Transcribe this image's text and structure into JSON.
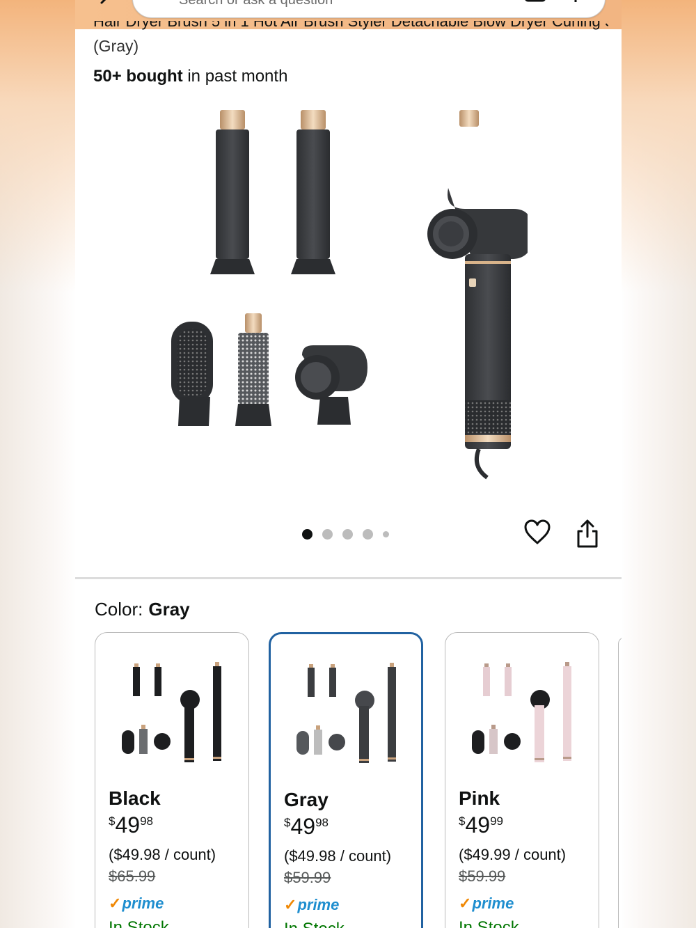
{
  "search": {
    "placeholder": "Search or ask a question"
  },
  "product": {
    "title_line_partial": "Hair Dryer Brush 5 in 1 Hot Air Brush Styler Detachable Blow Dryer Curling Styling Drying",
    "title_rest": "(Gray)",
    "bought_bold": "50+ bought",
    "bought_rest": " in past month"
  },
  "gallery": {
    "image_count": 5,
    "active_index": 0
  },
  "color_selector": {
    "label": "Color:",
    "selected": "Gray",
    "options": [
      {
        "name": "Black",
        "price_currency": "$",
        "price_whole": "49",
        "price_fraction": "98",
        "unit_price": "($49.98 / count)",
        "list_price": "$65.99",
        "prime": "prime",
        "stock": "In Stock"
      },
      {
        "name": "Gray",
        "price_currency": "$",
        "price_whole": "49",
        "price_fraction": "98",
        "unit_price": "($49.98 / count)",
        "list_price": "$59.99",
        "prime": "prime",
        "stock": "In Stock"
      },
      {
        "name": "Pink",
        "price_currency": "$",
        "price_whole": "49",
        "price_fraction": "99",
        "unit_price": "($49.99 / count)",
        "list_price": "$59.99",
        "prime": "prime",
        "stock": "In Stock"
      }
    ]
  },
  "colors": {
    "accent_header": "#f3b987",
    "selected_border": "#2162a1",
    "prime_blue": "#1f8ecf",
    "prime_check": "#f08804",
    "in_stock": "#007600",
    "product_gray": "#3b3d40",
    "product_gold": "#d9b58e",
    "product_pink": "#e9cfd3"
  },
  "icons": {
    "back": "back-arrow-icon",
    "search": "search-icon",
    "camera": "camera-icon",
    "mic": "mic-icon",
    "heart": "heart-icon",
    "share": "share-icon"
  }
}
